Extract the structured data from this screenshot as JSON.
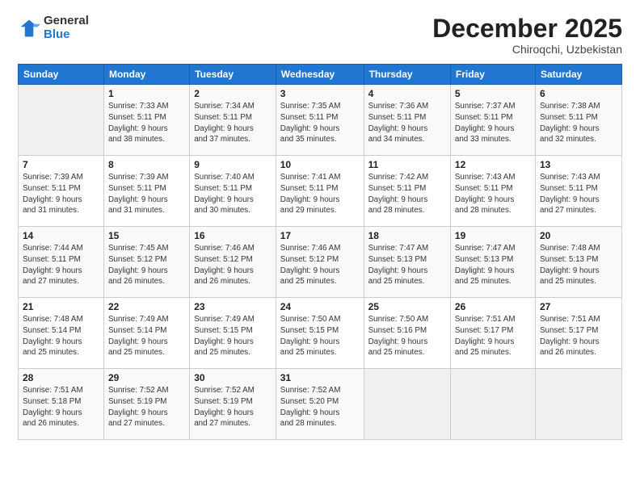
{
  "logo": {
    "general": "General",
    "blue": "Blue"
  },
  "header": {
    "month": "December 2025",
    "location": "Chiroqchi, Uzbekistan"
  },
  "weekdays": [
    "Sunday",
    "Monday",
    "Tuesday",
    "Wednesday",
    "Thursday",
    "Friday",
    "Saturday"
  ],
  "weeks": [
    [
      {
        "day": "",
        "info": ""
      },
      {
        "day": "1",
        "info": "Sunrise: 7:33 AM\nSunset: 5:11 PM\nDaylight: 9 hours\nand 38 minutes."
      },
      {
        "day": "2",
        "info": "Sunrise: 7:34 AM\nSunset: 5:11 PM\nDaylight: 9 hours\nand 37 minutes."
      },
      {
        "day": "3",
        "info": "Sunrise: 7:35 AM\nSunset: 5:11 PM\nDaylight: 9 hours\nand 35 minutes."
      },
      {
        "day": "4",
        "info": "Sunrise: 7:36 AM\nSunset: 5:11 PM\nDaylight: 9 hours\nand 34 minutes."
      },
      {
        "day": "5",
        "info": "Sunrise: 7:37 AM\nSunset: 5:11 PM\nDaylight: 9 hours\nand 33 minutes."
      },
      {
        "day": "6",
        "info": "Sunrise: 7:38 AM\nSunset: 5:11 PM\nDaylight: 9 hours\nand 32 minutes."
      }
    ],
    [
      {
        "day": "7",
        "info": "Sunrise: 7:39 AM\nSunset: 5:11 PM\nDaylight: 9 hours\nand 31 minutes."
      },
      {
        "day": "8",
        "info": "Sunrise: 7:39 AM\nSunset: 5:11 PM\nDaylight: 9 hours\nand 31 minutes."
      },
      {
        "day": "9",
        "info": "Sunrise: 7:40 AM\nSunset: 5:11 PM\nDaylight: 9 hours\nand 30 minutes."
      },
      {
        "day": "10",
        "info": "Sunrise: 7:41 AM\nSunset: 5:11 PM\nDaylight: 9 hours\nand 29 minutes."
      },
      {
        "day": "11",
        "info": "Sunrise: 7:42 AM\nSunset: 5:11 PM\nDaylight: 9 hours\nand 28 minutes."
      },
      {
        "day": "12",
        "info": "Sunrise: 7:43 AM\nSunset: 5:11 PM\nDaylight: 9 hours\nand 28 minutes."
      },
      {
        "day": "13",
        "info": "Sunrise: 7:43 AM\nSunset: 5:11 PM\nDaylight: 9 hours\nand 27 minutes."
      }
    ],
    [
      {
        "day": "14",
        "info": "Sunrise: 7:44 AM\nSunset: 5:11 PM\nDaylight: 9 hours\nand 27 minutes."
      },
      {
        "day": "15",
        "info": "Sunrise: 7:45 AM\nSunset: 5:12 PM\nDaylight: 9 hours\nand 26 minutes."
      },
      {
        "day": "16",
        "info": "Sunrise: 7:46 AM\nSunset: 5:12 PM\nDaylight: 9 hours\nand 26 minutes."
      },
      {
        "day": "17",
        "info": "Sunrise: 7:46 AM\nSunset: 5:12 PM\nDaylight: 9 hours\nand 25 minutes."
      },
      {
        "day": "18",
        "info": "Sunrise: 7:47 AM\nSunset: 5:13 PM\nDaylight: 9 hours\nand 25 minutes."
      },
      {
        "day": "19",
        "info": "Sunrise: 7:47 AM\nSunset: 5:13 PM\nDaylight: 9 hours\nand 25 minutes."
      },
      {
        "day": "20",
        "info": "Sunrise: 7:48 AM\nSunset: 5:13 PM\nDaylight: 9 hours\nand 25 minutes."
      }
    ],
    [
      {
        "day": "21",
        "info": "Sunrise: 7:48 AM\nSunset: 5:14 PM\nDaylight: 9 hours\nand 25 minutes."
      },
      {
        "day": "22",
        "info": "Sunrise: 7:49 AM\nSunset: 5:14 PM\nDaylight: 9 hours\nand 25 minutes."
      },
      {
        "day": "23",
        "info": "Sunrise: 7:49 AM\nSunset: 5:15 PM\nDaylight: 9 hours\nand 25 minutes."
      },
      {
        "day": "24",
        "info": "Sunrise: 7:50 AM\nSunset: 5:15 PM\nDaylight: 9 hours\nand 25 minutes."
      },
      {
        "day": "25",
        "info": "Sunrise: 7:50 AM\nSunset: 5:16 PM\nDaylight: 9 hours\nand 25 minutes."
      },
      {
        "day": "26",
        "info": "Sunrise: 7:51 AM\nSunset: 5:17 PM\nDaylight: 9 hours\nand 25 minutes."
      },
      {
        "day": "27",
        "info": "Sunrise: 7:51 AM\nSunset: 5:17 PM\nDaylight: 9 hours\nand 26 minutes."
      }
    ],
    [
      {
        "day": "28",
        "info": "Sunrise: 7:51 AM\nSunset: 5:18 PM\nDaylight: 9 hours\nand 26 minutes."
      },
      {
        "day": "29",
        "info": "Sunrise: 7:52 AM\nSunset: 5:19 PM\nDaylight: 9 hours\nand 27 minutes."
      },
      {
        "day": "30",
        "info": "Sunrise: 7:52 AM\nSunset: 5:19 PM\nDaylight: 9 hours\nand 27 minutes."
      },
      {
        "day": "31",
        "info": "Sunrise: 7:52 AM\nSunset: 5:20 PM\nDaylight: 9 hours\nand 28 minutes."
      },
      {
        "day": "",
        "info": ""
      },
      {
        "day": "",
        "info": ""
      },
      {
        "day": "",
        "info": ""
      }
    ]
  ]
}
